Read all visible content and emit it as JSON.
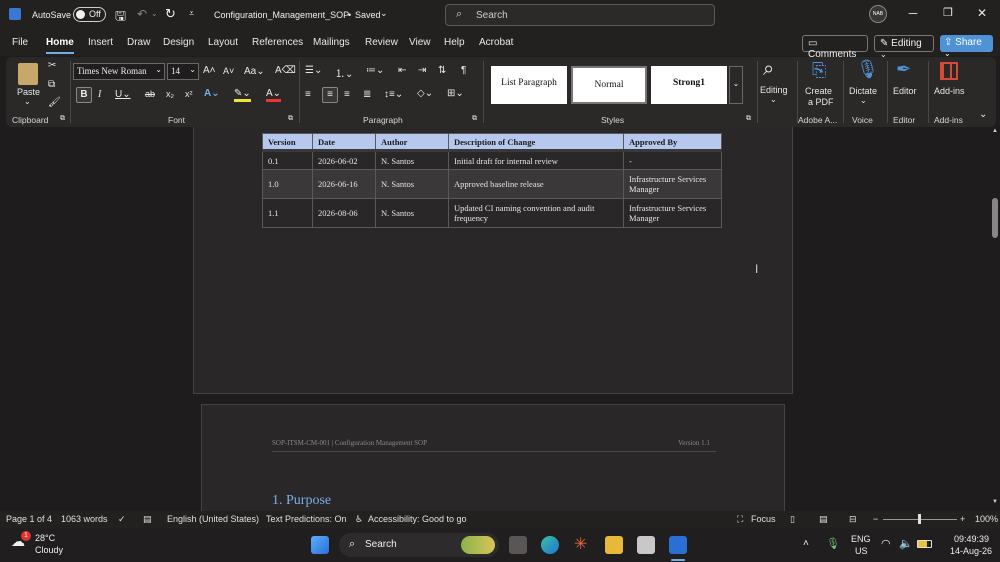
{
  "titlebar": {
    "autosave_label": "AutoSave",
    "autosave_state": "Off",
    "filename": "Configuration_Management_SOP",
    "saved_status": "Saved",
    "search_placeholder": "Search",
    "avatar_initials": "NAB"
  },
  "tabs": [
    "File",
    "Home",
    "Insert",
    "Draw",
    "Design",
    "Layout",
    "References",
    "Mailings",
    "Review",
    "View",
    "Help",
    "Acrobat"
  ],
  "active_tab": "Home",
  "top_actions": {
    "comments": "Comments",
    "editing": "Editing",
    "share": "Share"
  },
  "ribbon": {
    "clipboard": {
      "paste": "Paste",
      "label": "Clipboard"
    },
    "font": {
      "name": "Times New Roman",
      "size": "14",
      "label": "Font"
    },
    "paragraph": {
      "label": "Paragraph"
    },
    "styles": {
      "items": [
        "List Paragraph",
        "Normal",
        "Strong1"
      ],
      "label": "Styles"
    },
    "editing": {
      "label": "Editing"
    },
    "adobe": {
      "create_pdf_line1": "Create",
      "create_pdf_line2": "a PDF",
      "label": "Adobe A..."
    },
    "voice": {
      "dictate": "Dictate",
      "label": "Voice"
    },
    "editor": {
      "editor": "Editor",
      "label": "Editor"
    },
    "addins": {
      "addins": "Add-ins",
      "label": "Add-ins"
    }
  },
  "document": {
    "table_headers": [
      "Version",
      "Date",
      "Author",
      "Description of Change",
      "Approved By"
    ],
    "table_rows": [
      [
        "0.1",
        "2026-06-02",
        "N. Santos",
        "Initial draft for internal review",
        "-"
      ],
      [
        "1.0",
        "2026-06-16",
        "N. Santos",
        "Approved baseline release",
        "Infrastructure Services Manager"
      ],
      [
        "1.1",
        "2026-08-06",
        "N. Santos",
        "Updated CI naming convention and audit frequency",
        "Infrastructure Services Manager"
      ]
    ],
    "page2_header_left": "SOP-ITSM-CM-001 | Configuration Management SOP",
    "page2_header_right": "Version 1.1",
    "page2_heading": "1. Purpose"
  },
  "status": {
    "page": "Page 1 of 4",
    "words": "1063 words",
    "language": "English (United States)",
    "predictions": "Text Predictions: On",
    "accessibility": "Accessibility: Good to go",
    "focus": "Focus",
    "zoom": "100%"
  },
  "taskbar": {
    "weather_temp": "28°C",
    "weather_desc": "Cloudy",
    "weather_badge": "1",
    "search_label": "Search",
    "lang_line1": "ENG",
    "lang_line2": "US",
    "time": "09:49:39",
    "date": "14-Aug-26"
  },
  "colors": {
    "accent": "#4f93d6",
    "table_header": "#b7c8ef",
    "heading": "#7aaee8"
  }
}
